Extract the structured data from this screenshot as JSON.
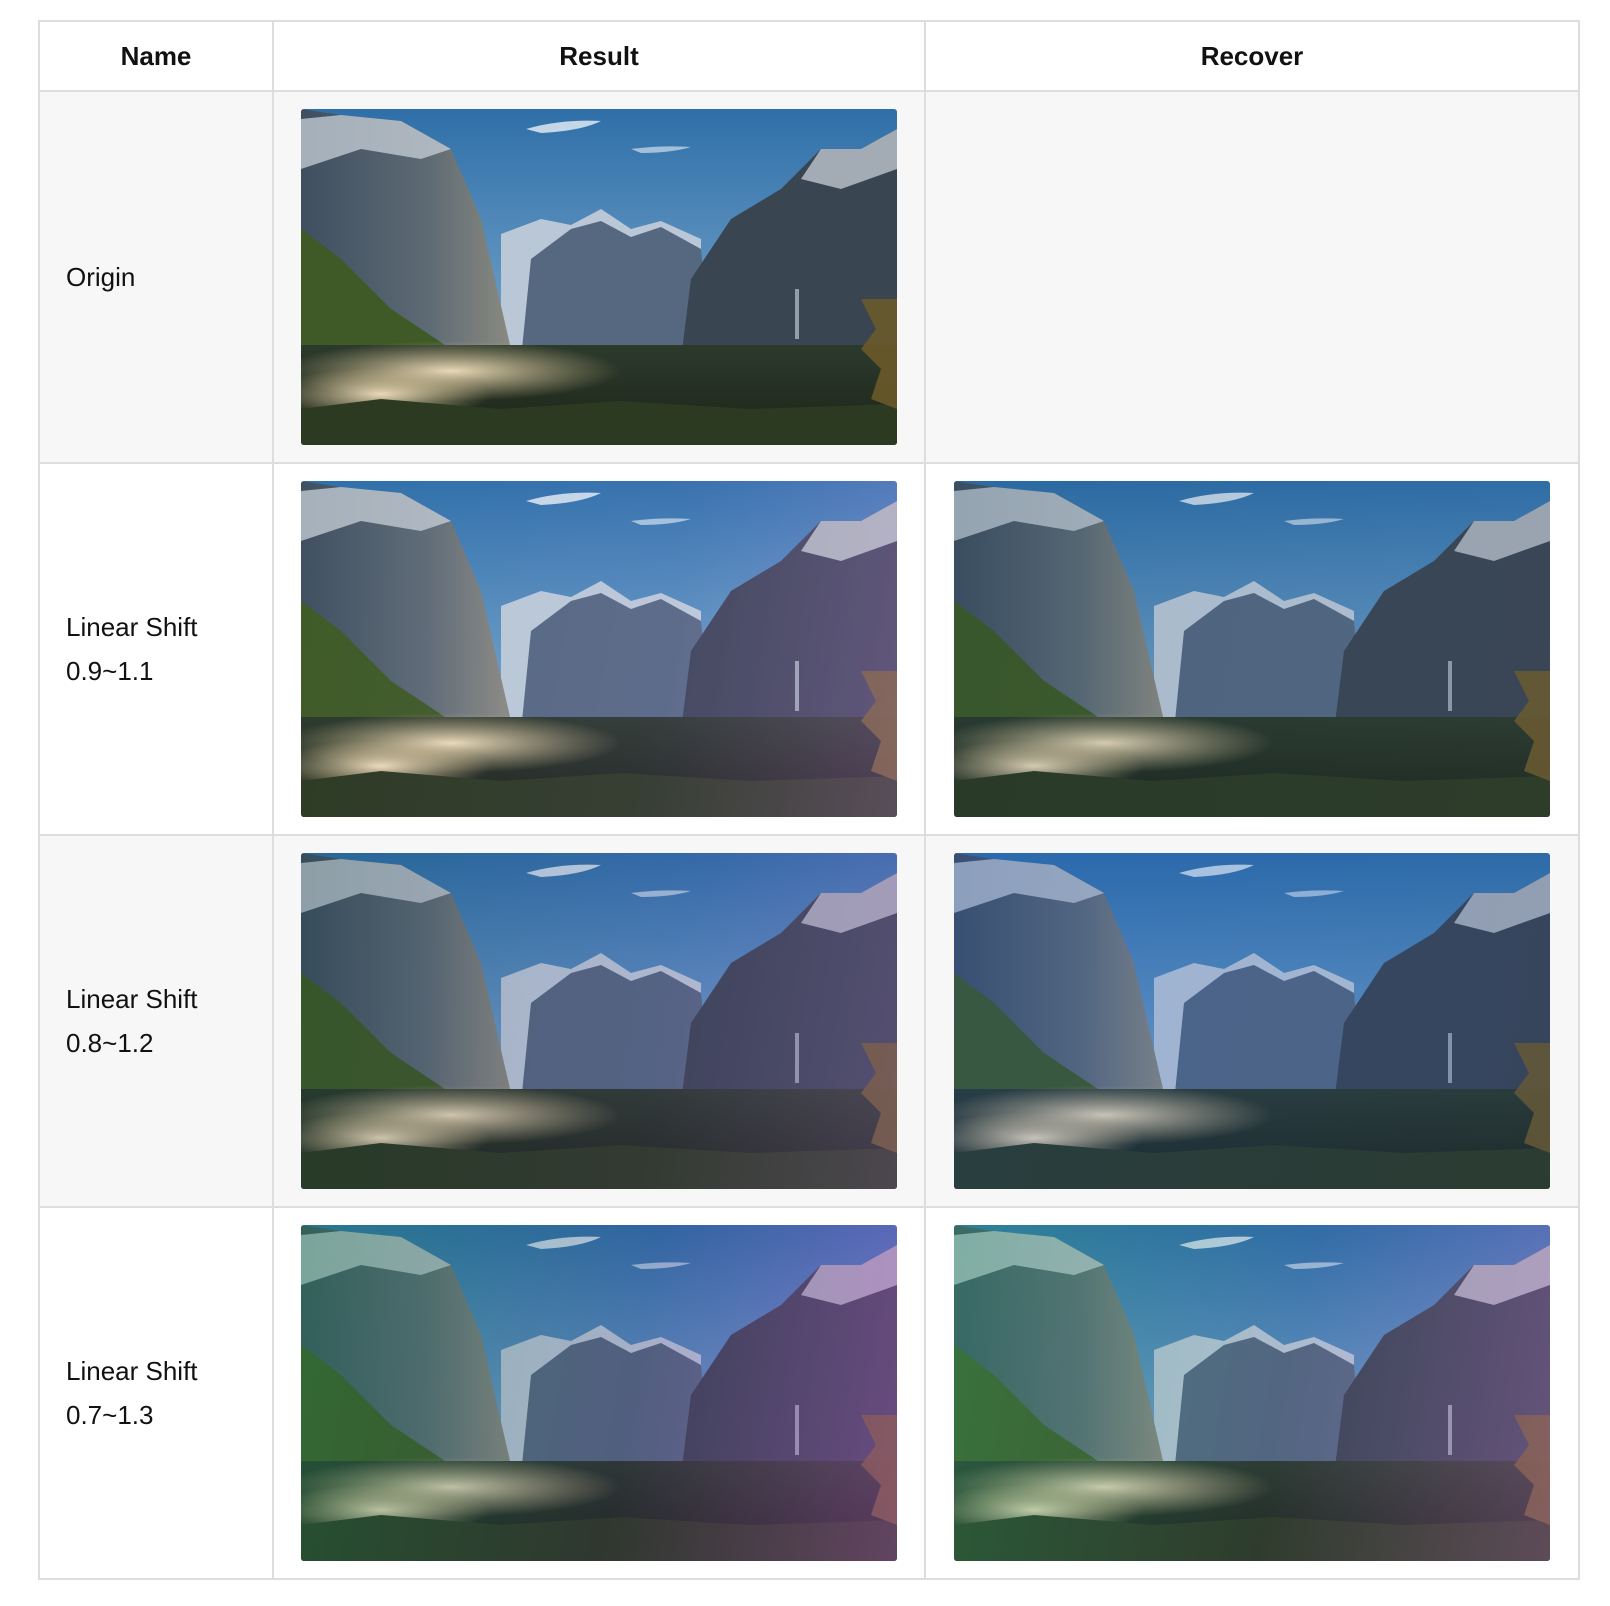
{
  "table": {
    "headers": [
      "Name",
      "Result",
      "Recover"
    ],
    "rows": [
      {
        "name_line1": "Origin",
        "name_line2": "",
        "has_result": true,
        "has_recover": false,
        "result_tint": "none",
        "recover_tint": "none"
      },
      {
        "name_line1": "Linear Shift",
        "name_line2": "0.9~1.1",
        "has_result": true,
        "has_recover": true,
        "result_tint": "purple-light",
        "recover_tint": "cool"
      },
      {
        "name_line1": "Linear Shift",
        "name_line2": "0.8~1.2",
        "has_result": true,
        "has_recover": true,
        "result_tint": "purple-medium",
        "recover_tint": "blue"
      },
      {
        "name_line1": "Linear Shift",
        "name_line2": "0.7~1.3",
        "has_result": true,
        "has_recover": true,
        "result_tint": "green-purple",
        "recover_tint": "green-purple-light"
      }
    ]
  },
  "colors": {
    "border": "#dddddd",
    "odd_row_bg": "#f7f7f7",
    "even_row_bg": "#ffffff"
  },
  "image_subject": "mountain-valley-landscape"
}
